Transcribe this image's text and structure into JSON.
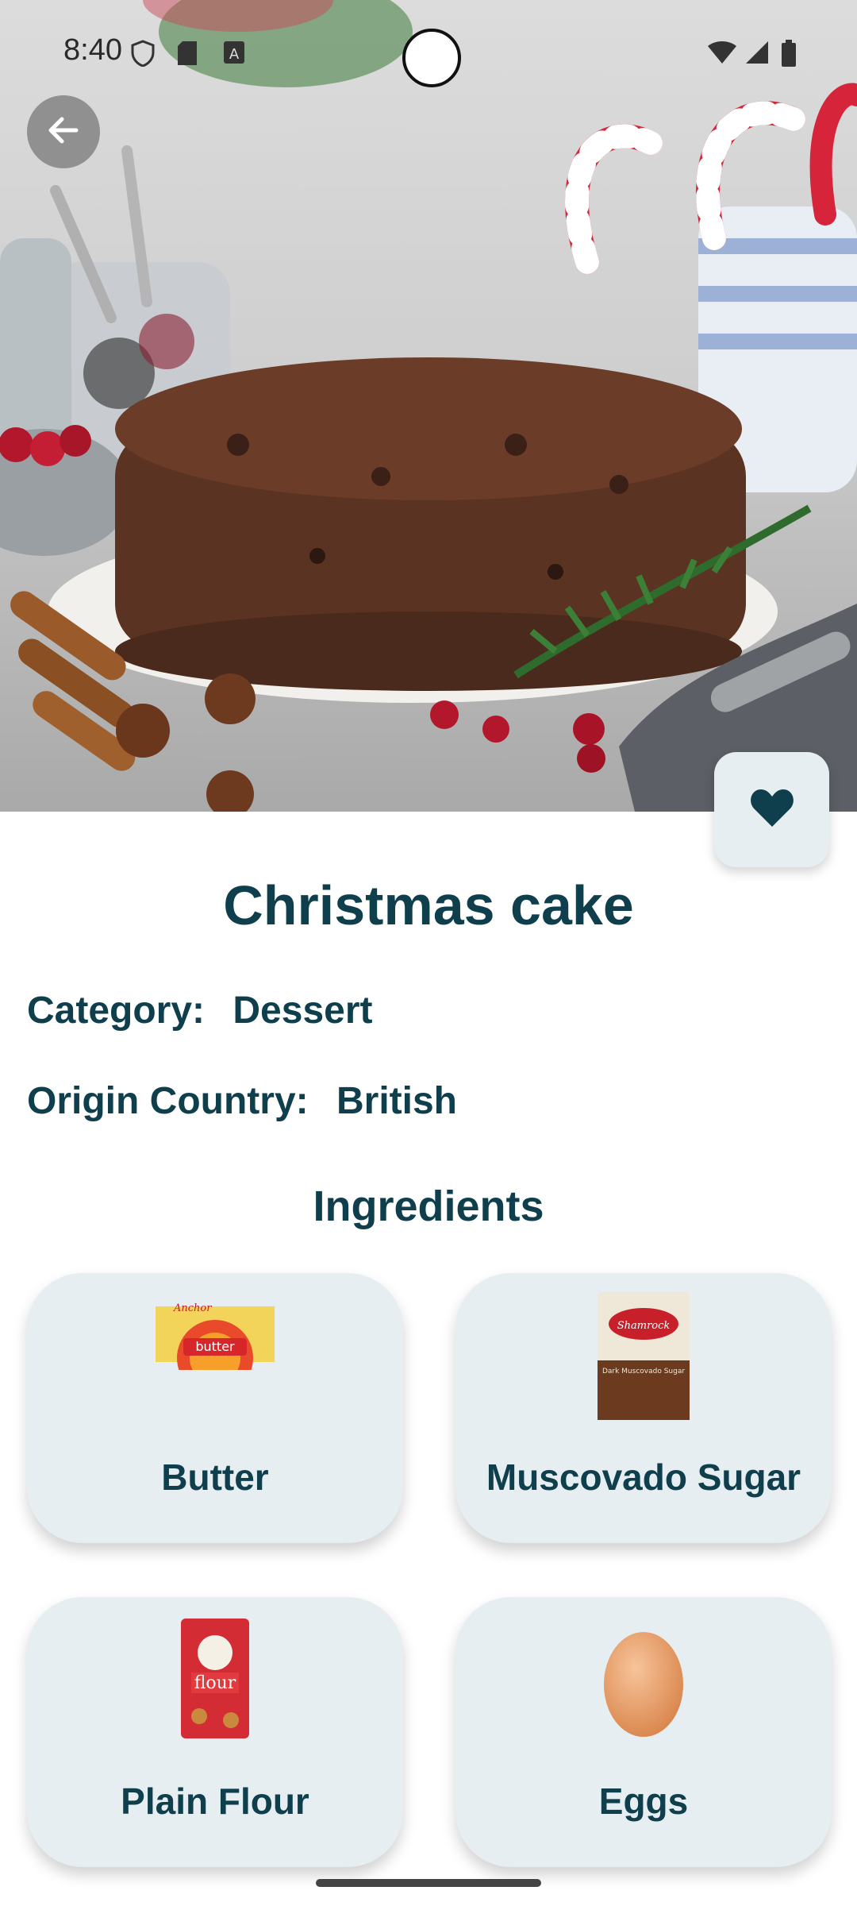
{
  "status_bar": {
    "time": "8:40"
  },
  "recipe": {
    "title": "Christmas cake",
    "category_label": "Category:",
    "category": "Dessert",
    "origin_label": "Origin Country:",
    "origin": "British"
  },
  "ingredients": {
    "heading": "Ingredients",
    "items": [
      {
        "name": "Butter"
      },
      {
        "name": "Muscovado Sugar"
      },
      {
        "name": "Plain Flour"
      },
      {
        "name": "Eggs"
      }
    ]
  },
  "package_text": {
    "butter_brand": "Anchor",
    "butter_word": "butter",
    "sugar_brand": "Shamrock",
    "sugar_product": "Dark Muscovado Sugar",
    "flour_word": "flour"
  },
  "colors": {
    "accent": "#0f3f4d",
    "card_bg": "#e6eef1"
  },
  "icons": {
    "back": "arrow-left-icon",
    "favorite": "heart-icon"
  }
}
